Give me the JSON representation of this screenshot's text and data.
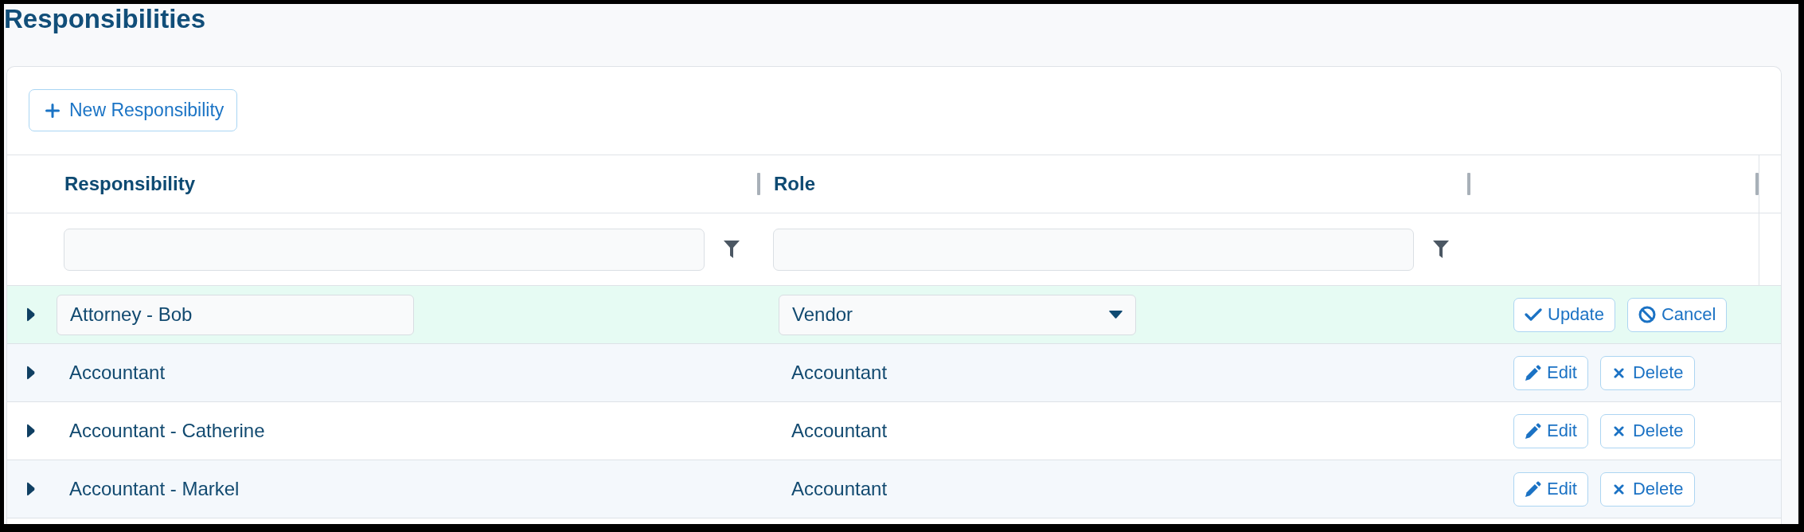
{
  "page": {
    "title": "Responsibilities"
  },
  "toolbar": {
    "new_button": {
      "label": "New Responsibility"
    }
  },
  "table": {
    "columns": [
      {
        "label": "Responsibility"
      },
      {
        "label": "Role"
      }
    ],
    "rows": [
      {
        "expanded": false,
        "editing": true,
        "responsibility": "Attorney - Bob",
        "role": "Vendor",
        "actions": [
          {
            "kind": "update",
            "label": "Update"
          },
          {
            "kind": "cancel",
            "label": "Cancel"
          }
        ]
      },
      {
        "expanded": false,
        "editing": false,
        "responsibility": "Accountant",
        "role": "Accountant",
        "actions": [
          {
            "kind": "edit",
            "label": "Edit"
          },
          {
            "kind": "delete",
            "label": "Delete"
          }
        ]
      },
      {
        "expanded": false,
        "editing": false,
        "responsibility": "Accountant - Catherine",
        "role": "Accountant",
        "actions": [
          {
            "kind": "edit",
            "label": "Edit"
          },
          {
            "kind": "delete",
            "label": "Delete"
          }
        ]
      },
      {
        "expanded": false,
        "editing": false,
        "responsibility": "Accountant - Markel",
        "role": "Accountant",
        "actions": [
          {
            "kind": "edit",
            "label": "Edit"
          },
          {
            "kind": "delete",
            "label": "Delete"
          }
        ]
      }
    ]
  }
}
